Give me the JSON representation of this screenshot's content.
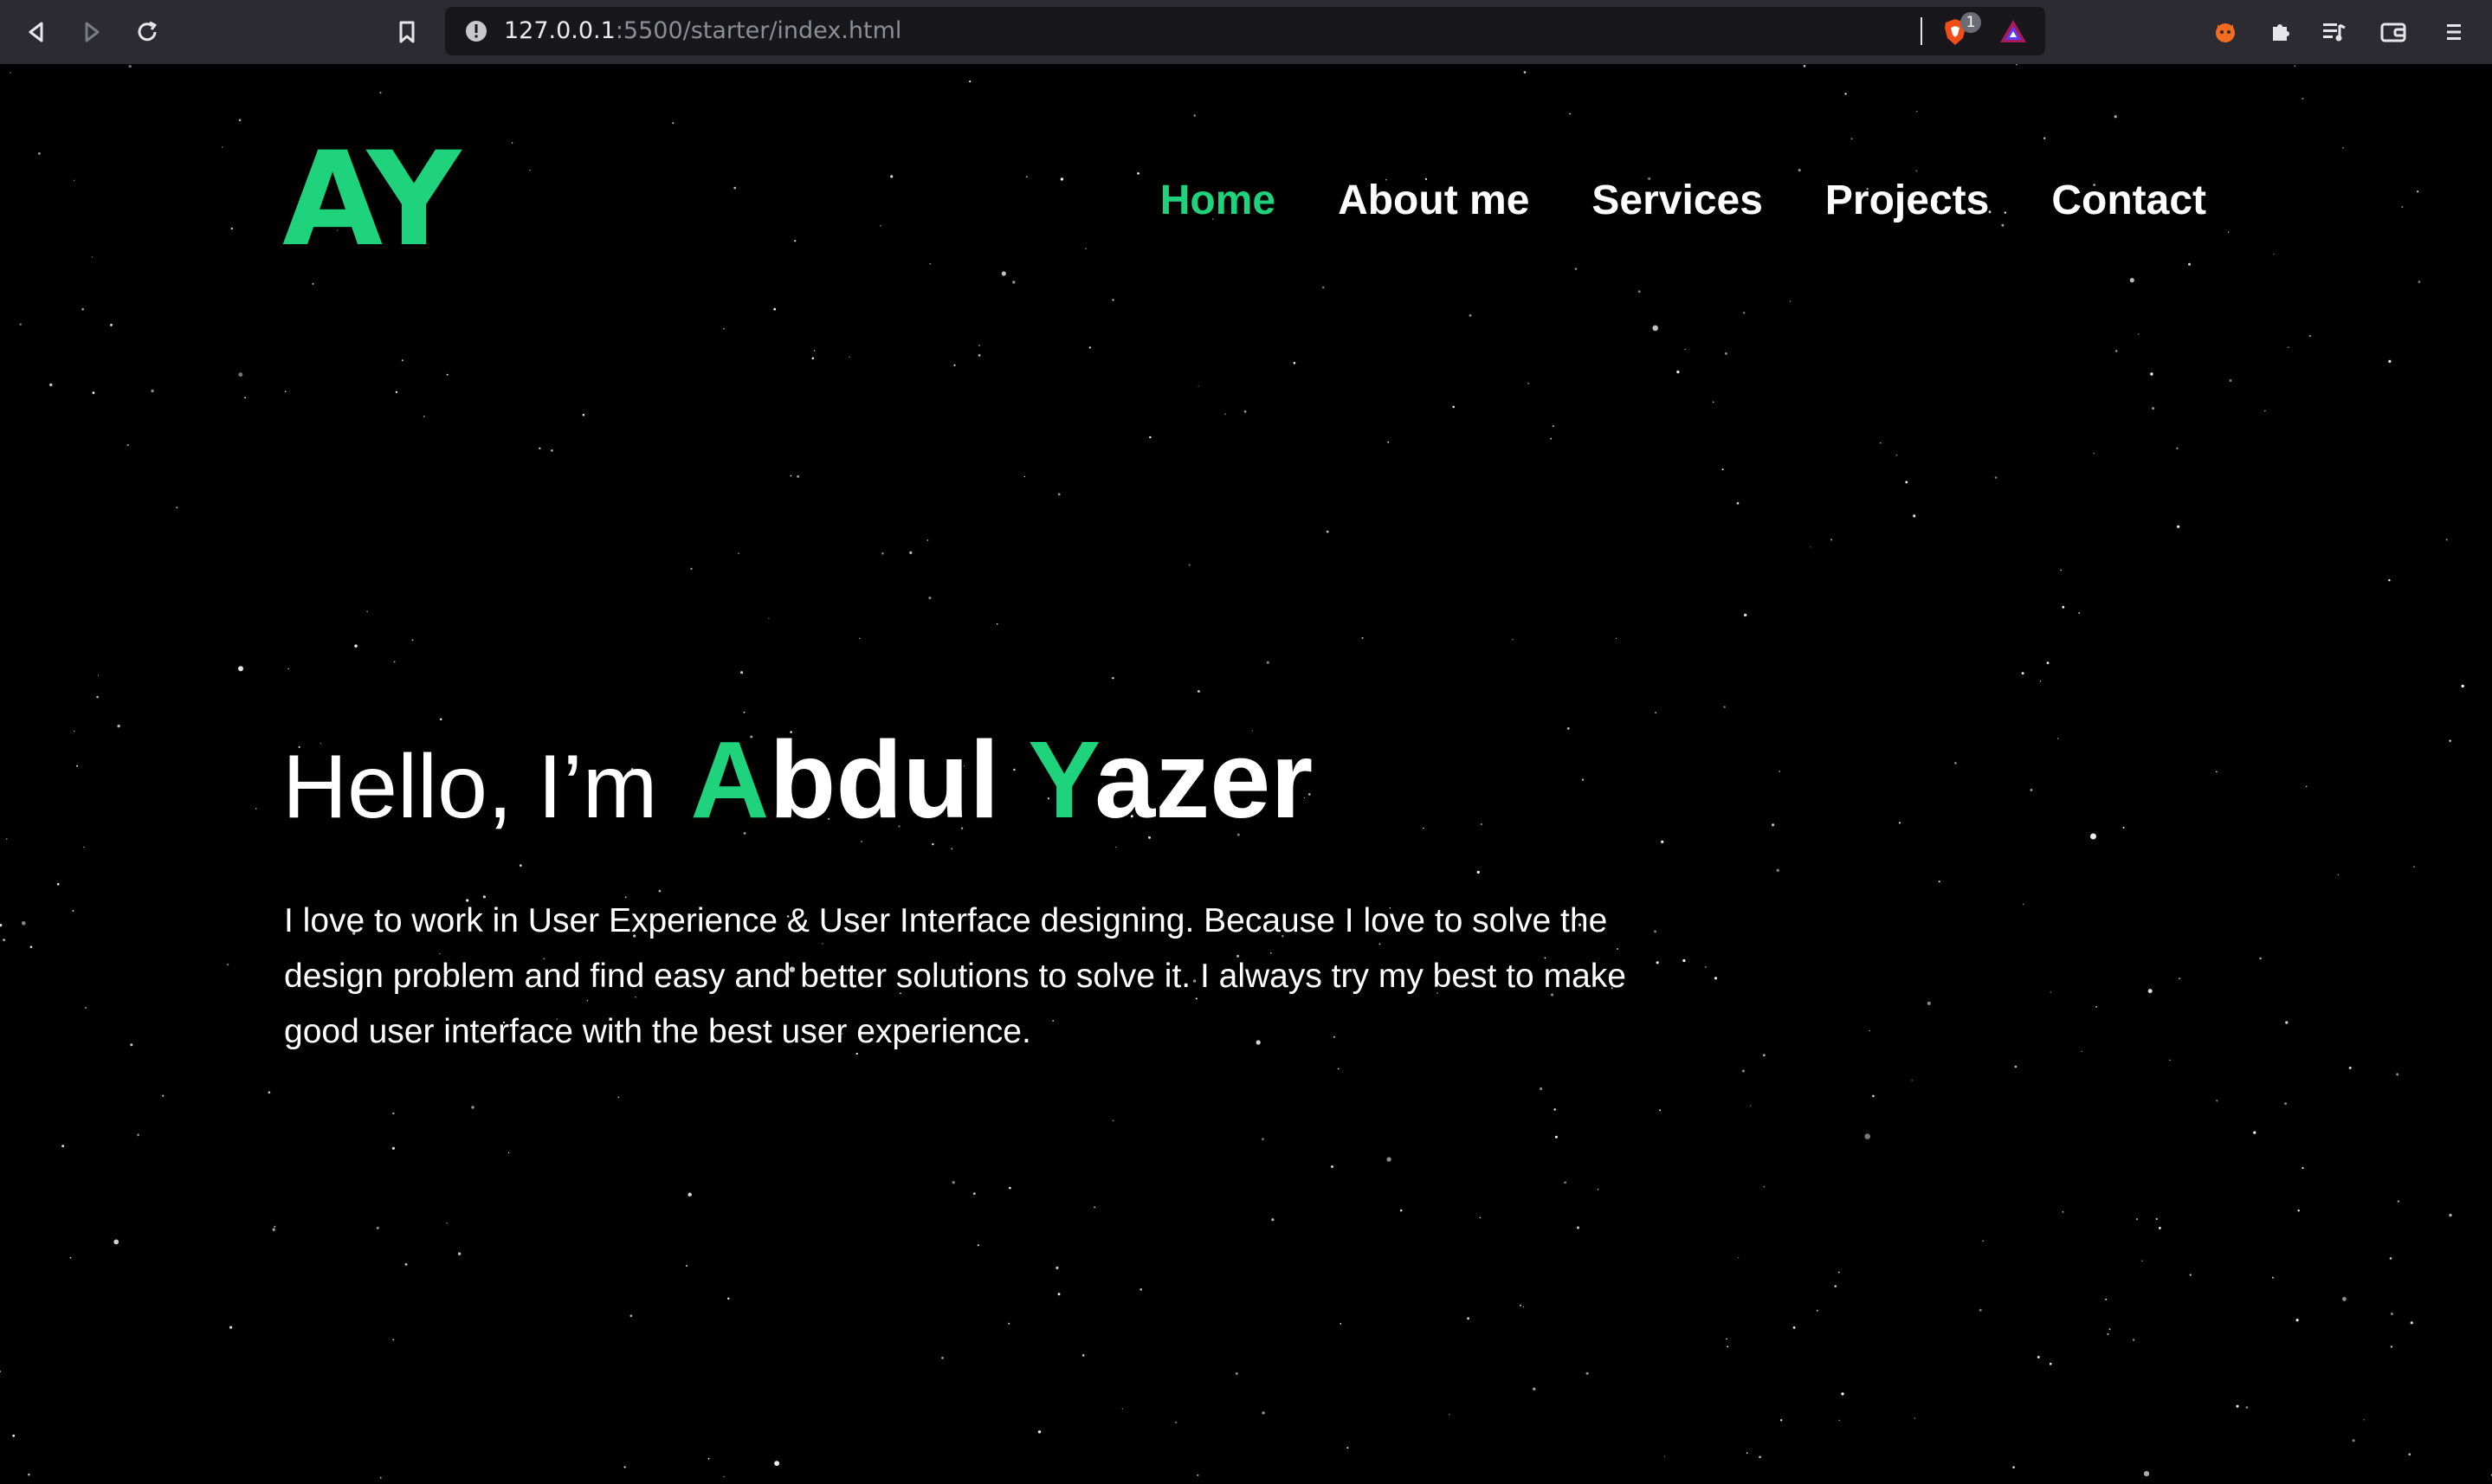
{
  "browser": {
    "url_host": "127.0.0.1",
    "url_path": ":5500/starter/index.html",
    "shields_badge_count": "1"
  },
  "site": {
    "logo": "AY",
    "nav": [
      {
        "label": "Home",
        "active": true
      },
      {
        "label": "About me",
        "active": false
      },
      {
        "label": "Services",
        "active": false
      },
      {
        "label": "Projects",
        "active": false
      },
      {
        "label": "Contact",
        "active": false
      }
    ]
  },
  "hero": {
    "greeting": "Hello, I’m",
    "name_first_initial": "A",
    "name_first_rest": "bdul",
    "name_last_initial": "Y",
    "name_last_rest": "azer",
    "description": "I love to work in User Experience & User Interface designing. Because I love to solve the design problem and find easy and better solutions to solve it. I always try my best to make good user interface with the best user experience."
  },
  "colors": {
    "accent": "#1fd37c",
    "background": "#000000",
    "chrome": "#2b2b31",
    "text": "#ffffff"
  }
}
